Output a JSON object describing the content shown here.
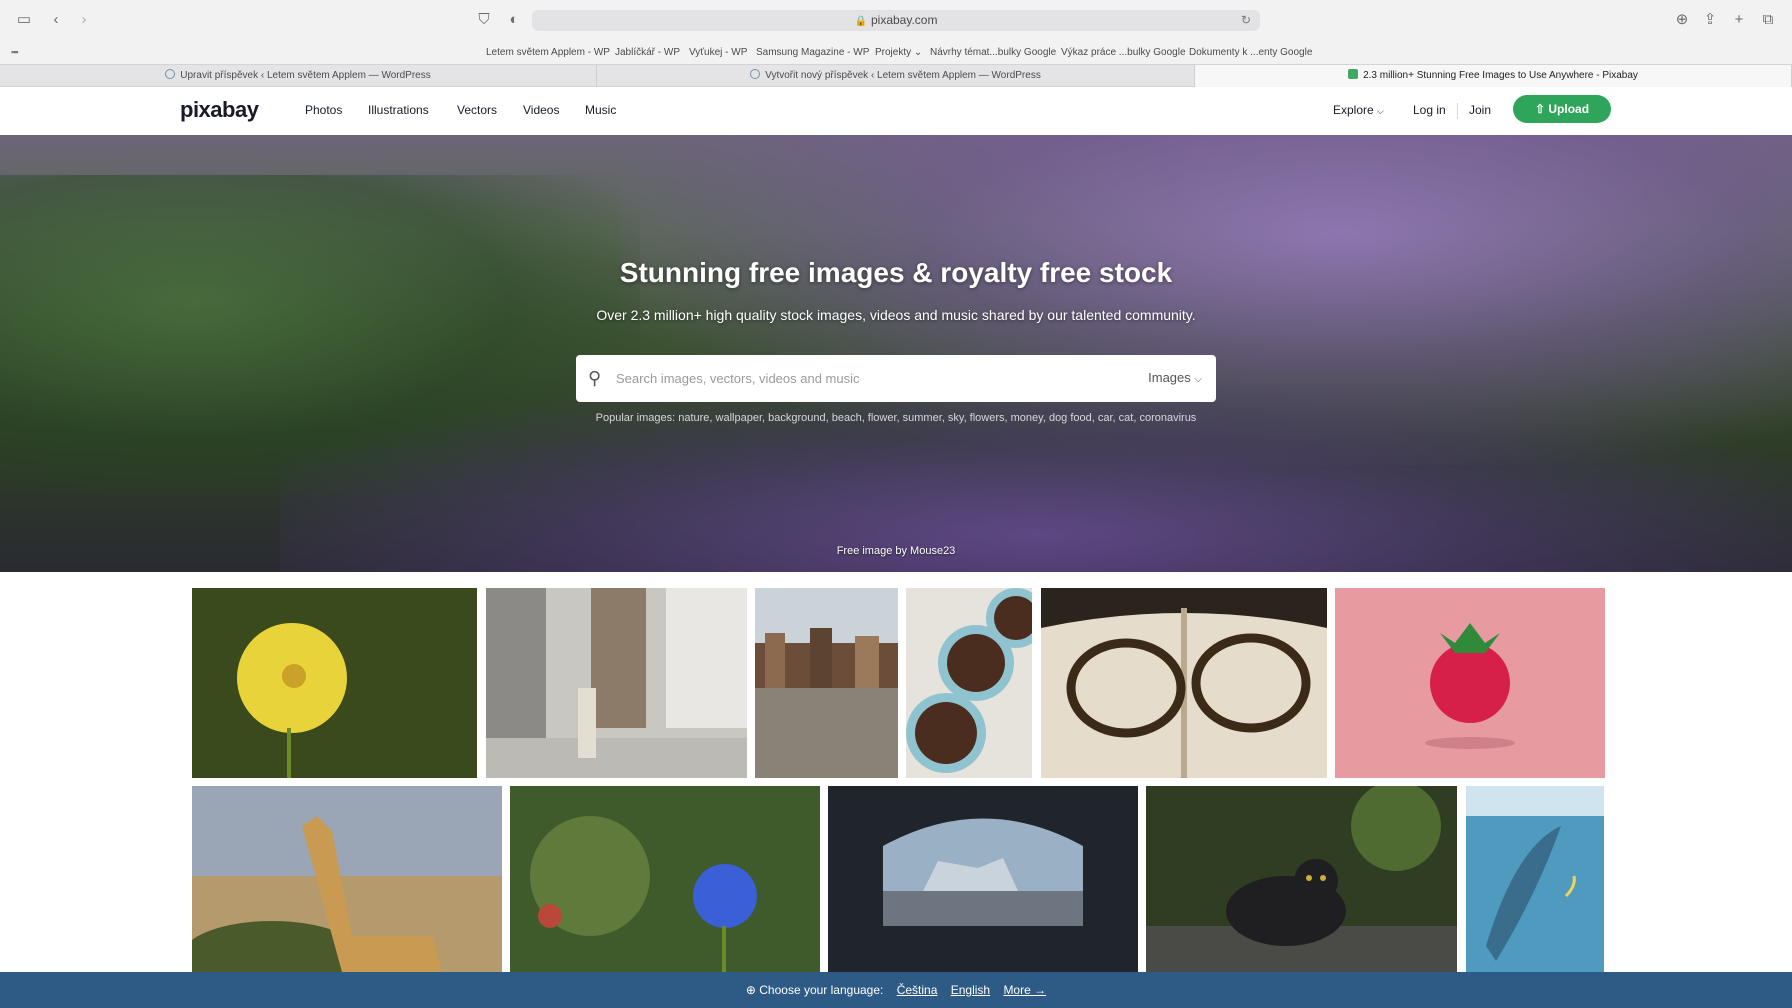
{
  "browser": {
    "url": "pixabay.com",
    "bookmarks": [
      "Letem světem Applem - WP",
      "Jablíčkář - WP",
      "Vyťukej - WP",
      "Samsung Magazine - WP",
      "Projekty ⌄",
      "Návrhy témat...bulky Google",
      "Výkaz práce ...bulky Google",
      "Dokumenty k ...enty Google"
    ],
    "tabs": [
      {
        "label": "Upravit příspěvek ‹ Letem světem Applem — WordPress",
        "active": false
      },
      {
        "label": "Vytvořit nový příspěvek ‹ Letem světem Applem — WordPress",
        "active": false
      },
      {
        "label": "2.3 million+ Stunning Free Images to Use Anywhere - Pixabay",
        "active": true
      }
    ]
  },
  "header": {
    "logo": "pixabay",
    "nav": [
      "Photos",
      "Illustrations",
      "Vectors",
      "Videos",
      "Music"
    ],
    "explore": "Explore",
    "login": "Log in",
    "join": "Join",
    "upload": "Upload",
    "brand_color": "#2fa55c"
  },
  "hero": {
    "title": "Stunning free images & royalty free stock",
    "subtitle": "Over 2.3 million+ high quality stock images, videos and music shared by our talented community.",
    "search_placeholder": "Search images, vectors, videos and music",
    "search_type": "Images",
    "popular_label": "Popular images:",
    "popular_terms": "nature, wallpaper, background, beach, flower, summer, sky, flowers, money, dog food, car, cat, coronavirus",
    "credit": "Free image by Mouse23"
  },
  "grid": {
    "images": [
      {
        "name": "yellow-poppy",
        "color": "#3c4a1e"
      },
      {
        "name": "ballerina-building",
        "color": "#a9a6a0"
      },
      {
        "name": "canal-houses",
        "color": "#9a8f7f"
      },
      {
        "name": "coffee-cups",
        "color": "#d8d4cc"
      },
      {
        "name": "glasses-book",
        "color": "#8a7a63"
      },
      {
        "name": "raspberry",
        "color": "#e79aa0"
      },
      {
        "name": "giraffe",
        "color": "#a59a86"
      },
      {
        "name": "blue-cornflower",
        "color": "#44602e"
      },
      {
        "name": "city-window",
        "color": "#2c3138"
      },
      {
        "name": "black-cat",
        "color": "#2f3a24"
      },
      {
        "name": "whale-illustration",
        "color": "#4f9bc0"
      }
    ]
  },
  "language_bar": {
    "label": "Choose your language:",
    "options": [
      "Čeština",
      "English",
      "More →"
    ],
    "color": "#2d5b86"
  }
}
